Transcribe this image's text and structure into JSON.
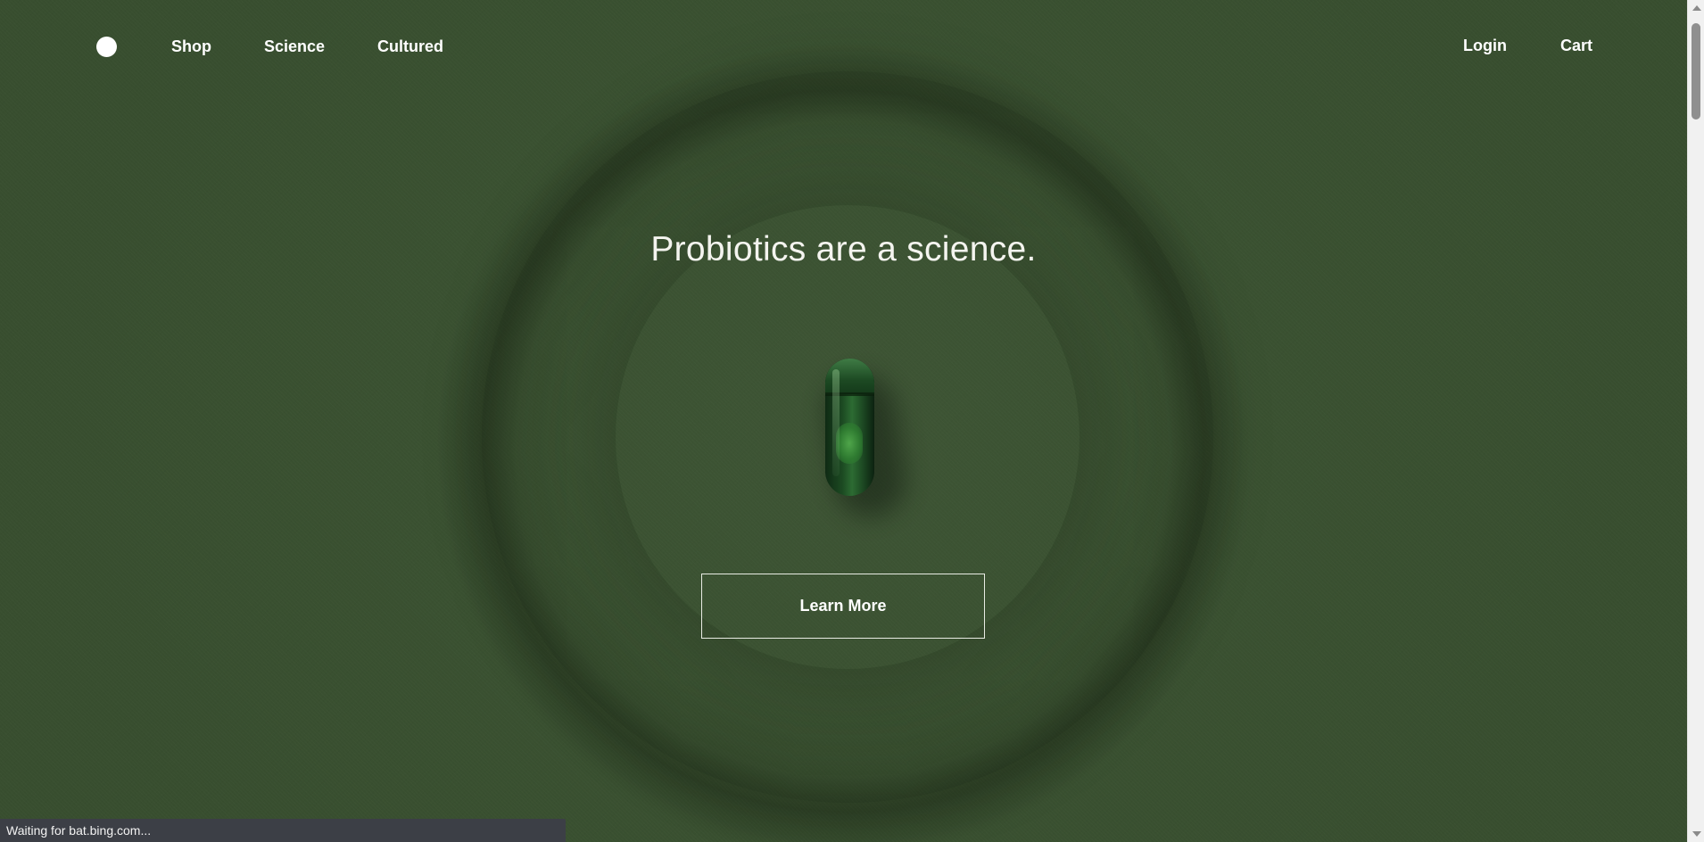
{
  "nav": {
    "logo_icon": "circle-logo-icon",
    "links": {
      "shop": "Shop",
      "science": "Science",
      "cultured": "Cultured"
    },
    "login": "Login",
    "cart": "Cart"
  },
  "hero": {
    "headline": "Probiotics are a science.",
    "image_icon": "capsule-icon",
    "cta_label": "Learn More"
  },
  "browser": {
    "status_text": "Waiting for bat.bing.com..."
  },
  "colors": {
    "background": "#3b5231",
    "text": "#ffffff",
    "capsule": "#1c4a22"
  }
}
